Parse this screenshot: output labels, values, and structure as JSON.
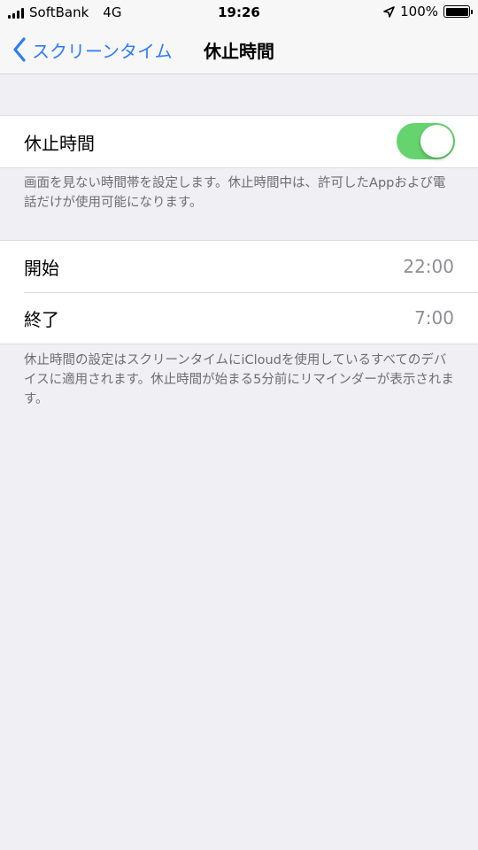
{
  "status_bar": {
    "carrier": "SoftBank",
    "network": "4G",
    "time": "19:26",
    "battery_percent": "100%",
    "battery_level": 1.0
  },
  "nav": {
    "back_label": "スクリーンタイム",
    "title": "休止時間",
    "accent_color": "#2f7cf6"
  },
  "downtime_toggle": {
    "label": "休止時間",
    "enabled": true,
    "on_color": "#65d36e"
  },
  "description": "画面を見ない時間帯を設定します。休止時間中は、許可したAppおよび電話だけが使用可能になります。",
  "schedule": {
    "start_label": "開始",
    "start_value": "22:00",
    "end_label": "終了",
    "end_value": "7:00"
  },
  "footer_note": "休止時間の設定はスクリーンタイムにiCloudを使用しているすべてのデバイスに適用されます。休止時間が始まる5分前にリマインダーが表示されます。"
}
